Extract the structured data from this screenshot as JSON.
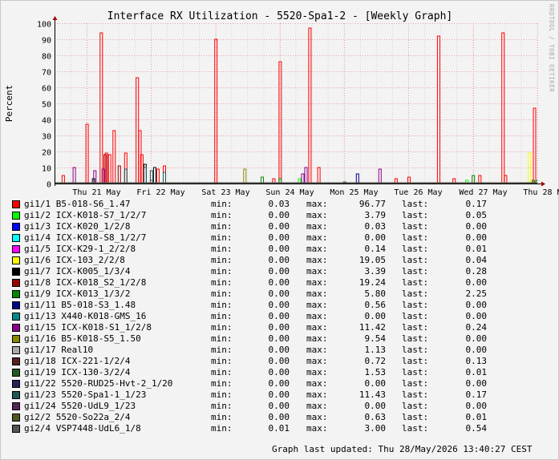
{
  "title": "Interface RX Utilization - 5520-Spa1-2 - [Weekly Graph]",
  "watermark": "RRDTOOL / TOBI OETIKER",
  "footer": "Graph last updated: Thu 28/May/2026 13:40:27 CEST",
  "legend_labels": {
    "min": "min:",
    "max": "max:",
    "last": "last:"
  },
  "chart_data": {
    "type": "line",
    "ylabel": "Percent",
    "ylim": [
      0,
      100
    ],
    "y_ticks": [
      0,
      10,
      20,
      30,
      40,
      50,
      60,
      70,
      80,
      90,
      100
    ],
    "x_ticks": [
      "Thu 21 May",
      "Fri 22 May",
      "Sat 23 May",
      "Sun 24 May",
      "Mon 25 May",
      "Tue 26 May",
      "Wed 27 May",
      "Thu 28 May"
    ],
    "x_start_day": 20.5,
    "x_end_day": 28.0,
    "grid": true,
    "series": [
      {
        "name": "gi1/1 B5-018-S6_1.47",
        "color": "#ff0000",
        "min": "0.03",
        "max": "96.77",
        "last": "0.17",
        "spikes": [
          [
            20.63,
            5
          ],
          [
            21.0,
            37
          ],
          [
            21.22,
            94
          ],
          [
            21.3,
            19
          ],
          [
            21.35,
            18
          ],
          [
            21.42,
            33
          ],
          [
            21.6,
            19
          ],
          [
            21.78,
            66
          ],
          [
            21.82,
            33
          ],
          [
            21.85,
            18
          ],
          [
            22.1,
            9
          ],
          [
            22.2,
            11
          ],
          [
            23.0,
            90
          ],
          [
            23.9,
            3
          ],
          [
            24.0,
            76
          ],
          [
            24.46,
            97
          ],
          [
            24.6,
            10
          ],
          [
            25.8,
            3
          ],
          [
            26.0,
            4
          ],
          [
            26.46,
            92
          ],
          [
            26.7,
            3
          ],
          [
            27.1,
            5
          ],
          [
            27.46,
            94
          ],
          [
            27.5,
            5
          ],
          [
            27.95,
            47
          ]
        ],
        "last_v": 0.17
      },
      {
        "name": "gi1/2 ICX-K018-S7_1/2/7",
        "color": "#00ff00",
        "min": "0.00",
        "max": "3.79",
        "last": "0.05",
        "spikes": [
          [
            24.3,
            3
          ],
          [
            26.9,
            2
          ]
        ],
        "last_v": 0.05
      },
      {
        "name": "gi1/3 ICX-K020_1/2/8",
        "color": "#0000ff",
        "min": "0.00",
        "max": "0.03",
        "last": "0.00",
        "spikes": [],
        "last_v": 0
      },
      {
        "name": "gi1/4 ICX-K018-S8_1/2/7",
        "color": "#00ffff",
        "min": "0.00",
        "max": "0.00",
        "last": "0.00",
        "spikes": [],
        "last_v": 0
      },
      {
        "name": "gi1/5 ICX-K29-1_2/2/8",
        "color": "#ff00ff",
        "min": "0.00",
        "max": "0.14",
        "last": "0.01",
        "spikes": [],
        "last_v": 0.01
      },
      {
        "name": "gi1/6 ICX-103_2/2/8",
        "color": "#ffff00",
        "min": "0.00",
        "max": "19.05",
        "last": "0.04",
        "spikes": [
          [
            27.87,
            19
          ]
        ],
        "last_v": 0.04
      },
      {
        "name": "gi1/7 ICX-K005_1/3/4",
        "color": "#000000",
        "min": "0.00",
        "max": "3.39",
        "last": "0.28",
        "spikes": [
          [
            21.1,
            3
          ],
          [
            21.9,
            12
          ],
          [
            22.05,
            10
          ]
        ],
        "last_v": 0.28
      },
      {
        "name": "gi1/8 ICX-K018_S2_1/2/8",
        "color": "#990000",
        "min": "0.00",
        "max": "19.24",
        "last": "0.00",
        "spikes": [
          [
            21.28,
            18
          ],
          [
            21.5,
            11
          ]
        ],
        "last_v": 0
      },
      {
        "name": "gi1/9 ICX-K013_1/3/2",
        "color": "#008800",
        "min": "0.00",
        "max": "5.80",
        "last": "2.25",
        "spikes": [
          [
            23.72,
            4
          ],
          [
            24.0,
            3
          ],
          [
            27.0,
            5
          ],
          [
            27.93,
            2
          ]
        ],
        "last_v": 2.25
      },
      {
        "name": "gi1/11 B5-018-S3_1.48",
        "color": "#000088",
        "min": "0.00",
        "max": "0.56",
        "last": "0.00",
        "spikes": [
          [
            25.2,
            6
          ]
        ],
        "last_v": 0
      },
      {
        "name": "gi1/13 X440-K018-GMS_16",
        "color": "#008888",
        "min": "0.00",
        "max": "0.00",
        "last": "0.00",
        "spikes": [],
        "last_v": 0
      },
      {
        "name": "gi1/15 ICX-K018-S1_1/2/8",
        "color": "#880088",
        "min": "0.00",
        "max": "11.42",
        "last": "0.24",
        "spikes": [
          [
            20.8,
            10
          ],
          [
            21.12,
            8
          ],
          [
            21.25,
            9
          ],
          [
            24.35,
            6
          ],
          [
            24.4,
            10
          ],
          [
            25.55,
            9
          ]
        ],
        "last_v": 0.24
      },
      {
        "name": "gi1/16 B5-K018-S5_1.50",
        "color": "#888800",
        "min": "0.00",
        "max": "9.54",
        "last": "0.00",
        "spikes": [
          [
            23.45,
            9
          ]
        ],
        "last_v": 0
      },
      {
        "name": "gi1/17 Real10",
        "color": "#aaaaaa",
        "min": "0.00",
        "max": "1.13",
        "last": "0.00",
        "spikes": [],
        "last_v": 0
      },
      {
        "name": "gi1/18 ICX-221-1/2/4",
        "color": "#552222",
        "min": "0.00",
        "max": "0.72",
        "last": "0.13",
        "spikes": [],
        "last_v": 0.13
      },
      {
        "name": "gi1/19 ICX-130-3/2/4",
        "color": "#225522",
        "min": "0.00",
        "max": "1.53",
        "last": "0.01",
        "spikes": [],
        "last_v": 0.01
      },
      {
        "name": "gi1/22 5520-RUD25-Hvt-2_1/20",
        "color": "#222255",
        "min": "0.00",
        "max": "0.00",
        "last": "0.00",
        "spikes": [],
        "last_v": 0
      },
      {
        "name": "gi1/23 5520-Spa1-1_1/23",
        "color": "#225555",
        "min": "0.00",
        "max": "11.43",
        "last": "0.17",
        "spikes": [
          [
            21.6,
            9
          ],
          [
            21.9,
            10
          ],
          [
            22.0,
            8
          ],
          [
            22.2,
            7
          ]
        ],
        "last_v": 0.17
      },
      {
        "name": "gi1/24 5520-UdL9_1/23",
        "color": "#552255",
        "min": "0.00",
        "max": "0.00",
        "last": "0.00",
        "spikes": [],
        "last_v": 0
      },
      {
        "name": "gi2/2 5520-So22a_2/4",
        "color": "#555522",
        "min": "0.00",
        "max": "0.63",
        "last": "0.01",
        "spikes": [],
        "last_v": 0.01
      },
      {
        "name": "gi2/4 VSP7448-UdL6_1/8",
        "color": "#555555",
        "min": "0.01",
        "max": "3.00",
        "last": "0.54",
        "spikes": [
          [
            22.0,
            2
          ],
          [
            25.0,
            1
          ]
        ],
        "last_v": 0.54
      }
    ]
  }
}
